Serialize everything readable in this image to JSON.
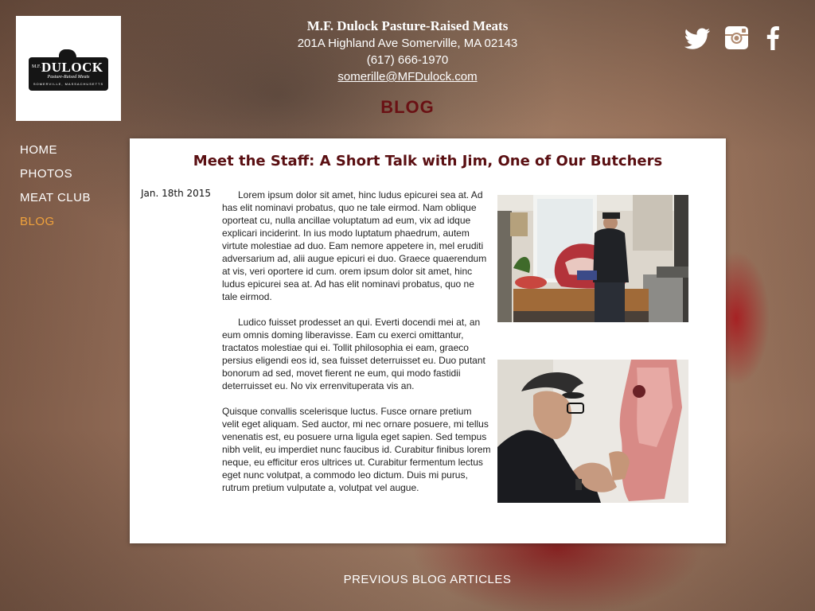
{
  "business": {
    "name": "M.F. Dulock Pasture-Raised Meats",
    "address": "201A Highland Ave Somerville, MA 02143",
    "phone": "(617) 666-1970",
    "email": "somerille@MFDulock.com"
  },
  "logo": {
    "mf": "M.F.",
    "name": "DULOCK",
    "tagline": "Pasture-Raised Meats",
    "town": "SOMERVILLE, MASSACHUSETTS"
  },
  "page_heading": "BLOG",
  "social": [
    "twitter-icon",
    "instagram-icon",
    "facebook-icon"
  ],
  "nav": {
    "items": [
      {
        "label": "HOME"
      },
      {
        "label": "PHOTOS"
      },
      {
        "label": "MEAT CLUB"
      },
      {
        "label": "BLOG"
      }
    ],
    "active": "BLOG"
  },
  "post": {
    "title": "Meet the Staff: A Short Talk with Jim, One of Our Butchers",
    "date": "Jan. 18th 2015",
    "paragraphs": [
      "Lorem ipsum dolor sit amet, hinc ludus epicurei sea at. Ad has elit nominavi probatus, quo ne tale eirmod. Nam oblique oporteat cu, nulla ancillae voluptatum ad eum, vix ad idque explicari inciderint. In ius modo luptatum phaedrum, autem virtute molestiae ad duo. Eam nemore appetere in, mel eruditi adversarium ad, alii augue epicuri ei duo. Graece quaerendum at vis, veri oportere id cum. orem ipsum dolor sit amet, hinc ludus epicurei sea at. Ad has elit nominavi probatus, quo ne tale eirmod.",
      "Ludico fuisset prodesset an qui. Everti docendi mei at, an eum omnis doming liberavisse. Eam cu exerci omittantur, tractatos molestiae qui ei. Tollit philosophia ei eam, graeco persius eligendi eos id, sea fuisset deterruisset eu. Duo putant bonorum ad sed, movet fierent ne eum, qui modo fastidii deterruisset eu. No vix errenvituperata vis an.",
      "Quisque convallis scelerisque luctus. Fusce ornare pretium velit eget aliquam. Sed auctor, mi nec ornare posuere, mi tellus venenatis est, eu posuere urna ligula eget sapien. Sed tempus nibh velit, eu imperdiet nunc faucibus id. Curabitur finibus lorem neque, eu efficitur eros ultrices ut. Curabitur fermentum lectus eget nunc volutpat, a commodo leo dictum. Duis mi purus, rutrum pretium vulputate a, volutpat vel augue."
    ]
  },
  "previous_link": "PREVIOUS BLOG ARTICLES"
}
